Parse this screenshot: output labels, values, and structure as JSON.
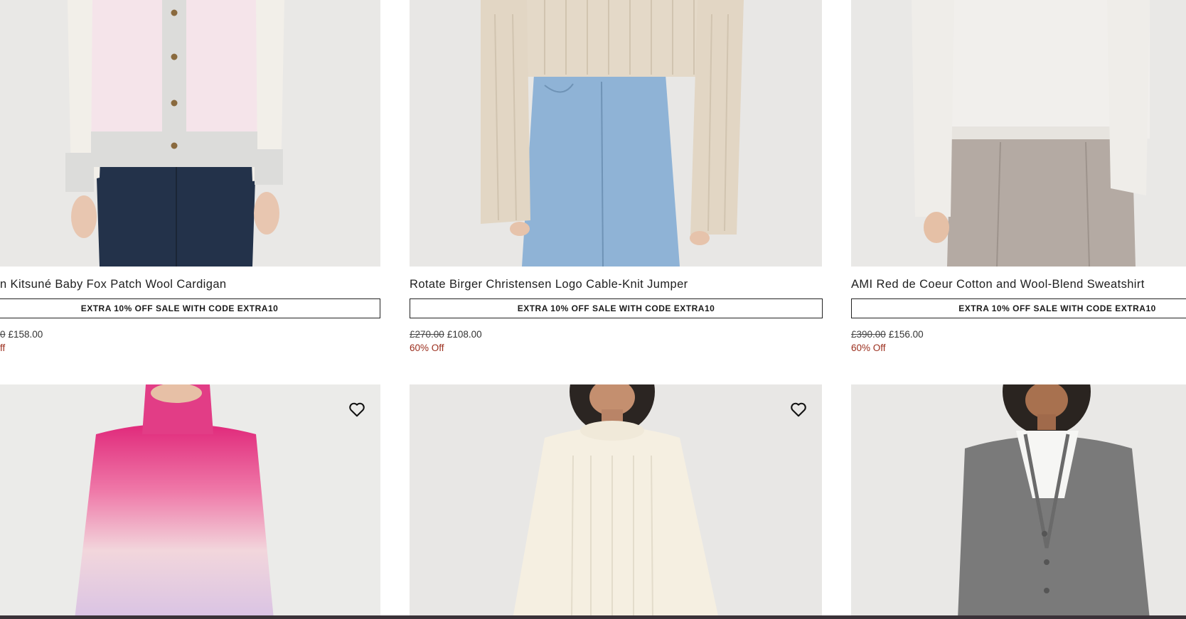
{
  "products": [
    {
      "title": "n Kitsuné Baby Fox Patch Wool Cardigan",
      "promo": "EXTRA 10% OFF SALE WITH CODE EXTRA10",
      "was_price": "0",
      "now_price": "£158.00",
      "discount": "ff"
    },
    {
      "title": "Rotate Birger Christensen Logo Cable-Knit Jumper",
      "promo": "EXTRA 10% OFF SALE WITH CODE EXTRA10",
      "was_price": "£270.00",
      "now_price": "£108.00",
      "discount": "60% Off"
    },
    {
      "title": "AMI Red de Coeur Cotton and Wool-Blend Sweatshirt",
      "promo": "EXTRA 10% OFF SALE WITH CODE EXTRA10",
      "was_price": "£390.00",
      "now_price": "£156.00",
      "discount": "60% Off"
    },
    {
      "wishlist_icon": "heart-outline-icon"
    },
    {
      "wishlist_icon": "heart-outline-icon"
    },
    {}
  ],
  "colors": {
    "discount": "#9b2e1d",
    "promo_border": "#222222",
    "image_bg": "#e7e7e7"
  }
}
